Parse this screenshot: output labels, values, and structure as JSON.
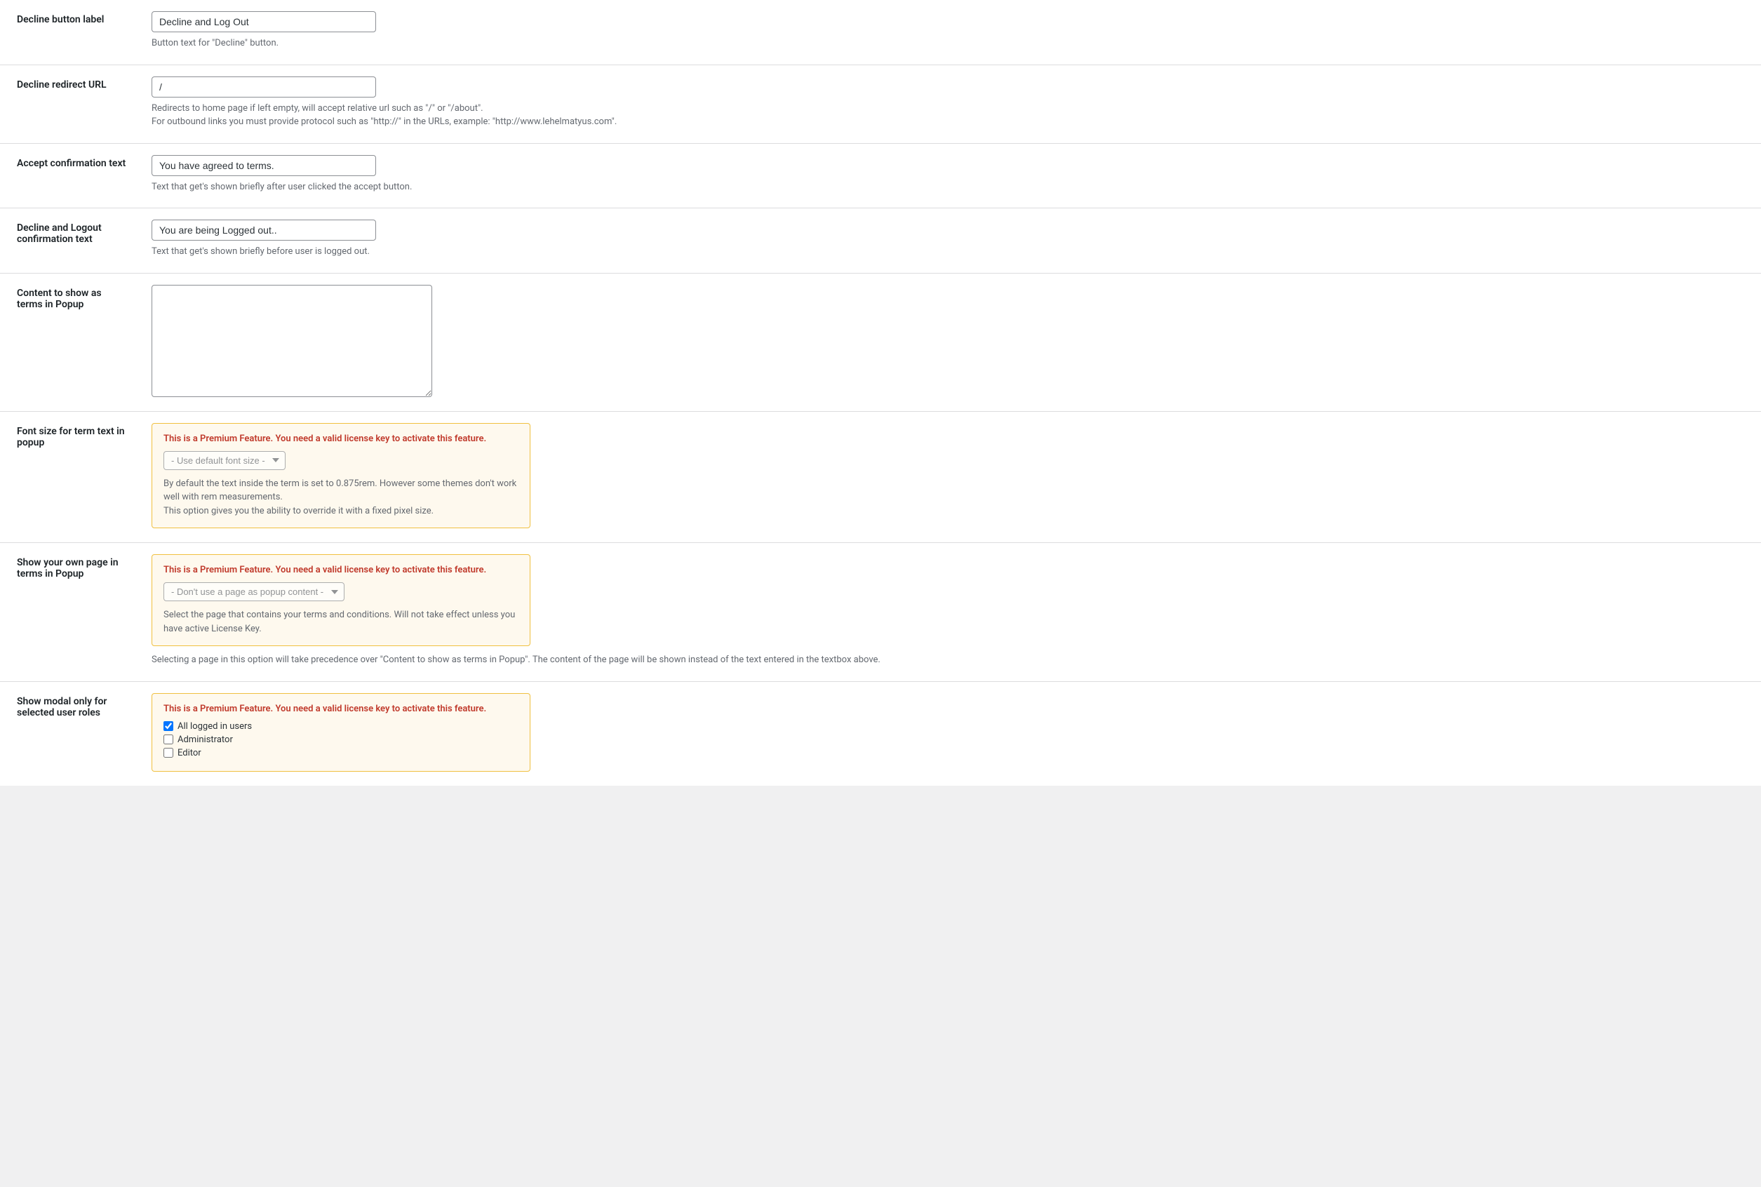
{
  "rows": [
    {
      "id": "decline-button-label",
      "label": "Decline button label",
      "type": "text-input",
      "value": "Decline and Log Out",
      "help": "Button text for \"Decline\" button."
    },
    {
      "id": "decline-redirect-url",
      "label": "Decline redirect URL",
      "type": "text-input",
      "value": "/",
      "help": "Redirects to home page if left empty, will accept relative url such as \"/\" or \"/about\".\nFor outbound links you must provide protocol such as \"http://\" in the URLs, example: \"http://www.lehelmatyus.com\"."
    },
    {
      "id": "accept-confirmation-text",
      "label": "Accept confirmation text",
      "type": "text-input",
      "value": "You have agreed to terms.",
      "help": "Text that get's shown briefly after user clicked the accept button."
    },
    {
      "id": "decline-logout-confirmation-text",
      "label": "Decline and Logout confirmation text",
      "type": "text-input",
      "value": "You are being Logged out..",
      "help": "Text that get's shown briefly before user is logged out."
    },
    {
      "id": "content-popup-terms",
      "label": "Content to show as terms in Popup",
      "type": "textarea",
      "value": "",
      "help": ""
    },
    {
      "id": "font-size-term-popup",
      "label": "Font size for term text in popup",
      "type": "premium-select",
      "premium_notice": "This is a Premium Feature. You need a valid license key to activate this feature.",
      "select_value": "- Use default font size -",
      "help": "By default the text inside the term is set to 0.875rem. However some themes don't work well with rem measurements.\nThis option gives you the ability to override it with a fixed pixel size."
    },
    {
      "id": "show-own-page-popup",
      "label": "Show your own page in terms in Popup",
      "type": "premium-select-page",
      "premium_notice": "This is a Premium Feature. You need a valid license key to activate this feature.",
      "select_value": "- Don't use a page as popup content -",
      "help": "Select the page that contains your terms and conditions. Will not take effect unless you have active License Key.",
      "bottom_note": "Selecting a page in this option will take precedence over \"Content to show as terms in Popup\". The content of the page will be shown instead of the text entered in the textbox above."
    },
    {
      "id": "show-modal-user-roles",
      "label": "Show modal only for selected user roles",
      "type": "premium-checkbox",
      "premium_notice": "This is a Premium Feature. You need a valid license key to activate this feature.",
      "checkboxes": [
        {
          "label": "All logged in users",
          "checked": true
        },
        {
          "label": "Administrator",
          "checked": false
        },
        {
          "label": "Editor",
          "checked": false
        }
      ]
    }
  ]
}
